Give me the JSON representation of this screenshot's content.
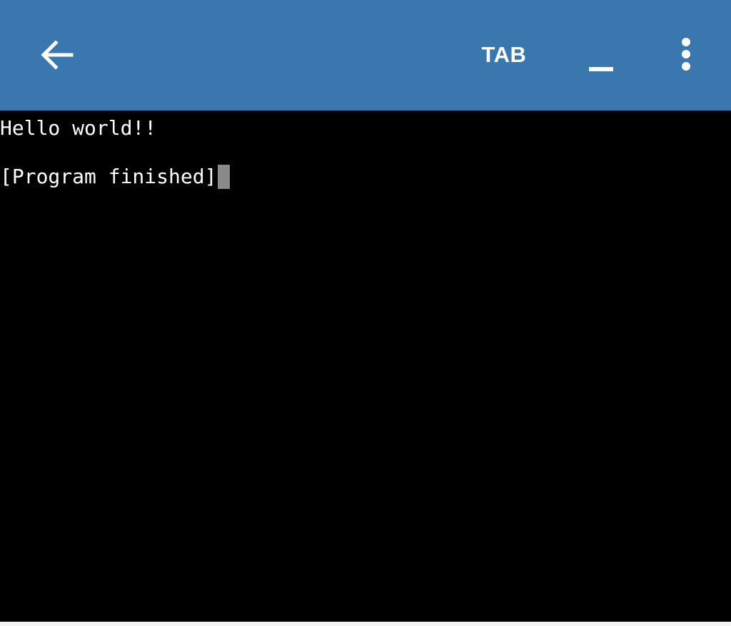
{
  "toolbar": {
    "background_color": "#3977ae",
    "back_icon": "arrow-left-icon",
    "tab_label": "TAB",
    "underscore_key": "_",
    "menu_icon": "more-vertical-icon"
  },
  "terminal": {
    "background_color": "#000000",
    "text_color": "#ffffff",
    "cursor_color": "#8a8a8a",
    "lines": [
      "Hello world!!",
      "[Program finished]"
    ]
  }
}
